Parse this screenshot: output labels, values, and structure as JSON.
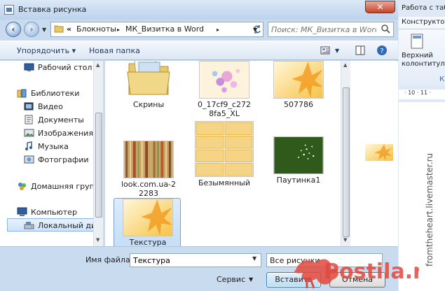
{
  "dialog": {
    "title": "Вставка рисунка",
    "close_glyph": "✕",
    "breadcrumbs": [
      "Блокноты",
      "МК_Визитка в Word"
    ],
    "crumb_prefix": "«",
    "crumb_sep": "▸",
    "search_placeholder": "Поиск: МК_Визитка в Word",
    "toolbar": {
      "organize": "Упорядочить ▾",
      "new_folder": "Новая папка"
    },
    "nav": [
      {
        "label": "Рабочий стол",
        "icon": "desktop-icon",
        "level": 1
      },
      {
        "label": "Библиотеки",
        "icon": "libraries-icon",
        "level": 0
      },
      {
        "label": "Видео",
        "icon": "video-icon",
        "level": 1
      },
      {
        "label": "Документы",
        "icon": "documents-icon",
        "level": 1
      },
      {
        "label": "Изображения",
        "icon": "pictures-icon",
        "level": 1
      },
      {
        "label": "Музыка",
        "icon": "music-icon",
        "level": 1
      },
      {
        "label": "Фотографии",
        "icon": "photos-icon",
        "level": 1
      },
      {
        "label": "Домашняя группа",
        "icon": "homegroup-icon",
        "level": 0
      },
      {
        "label": "Компьютер",
        "icon": "computer-icon",
        "level": 0
      },
      {
        "label": "Локальный диск",
        "icon": "disk-icon",
        "level": 1,
        "selected": true
      }
    ],
    "files": [
      {
        "name": "Скрины",
        "kind": "folder"
      },
      {
        "name": "0_17cf9_c2728fa5_XL",
        "kind": "flowers"
      },
      {
        "name": "507786",
        "kind": "warm"
      },
      {
        "name": "look.com.ua-22283",
        "kind": "stripes"
      },
      {
        "name": "Безымянный",
        "kind": "cards"
      },
      {
        "name": "Паутинка1",
        "kind": "green"
      },
      {
        "name": "Текстура",
        "kind": "warm",
        "selected": true
      }
    ],
    "filename_label": "Имя файла:",
    "filename_value": "Текстура",
    "filetype_value": "Все рисунки",
    "service_label": "Сервис",
    "insert_label": "Вставить",
    "cancel_label": "Отмена"
  },
  "word": {
    "title": "Работа с табл",
    "tab": "Конструктор",
    "ribbon_button_line1": "Верхний",
    "ribbon_button_line2": "колонтитул",
    "ribbon_group_letter": "К",
    "ruler": "· 10 · 11 ·"
  },
  "watermark": "fromtheheart.livemaster.ru",
  "logo_text": "Postila.ru",
  "colors": {
    "accent": "#3c7fb1",
    "close": "#c7432b",
    "logo": "#e2483d",
    "selection": "#cfe3f8"
  }
}
